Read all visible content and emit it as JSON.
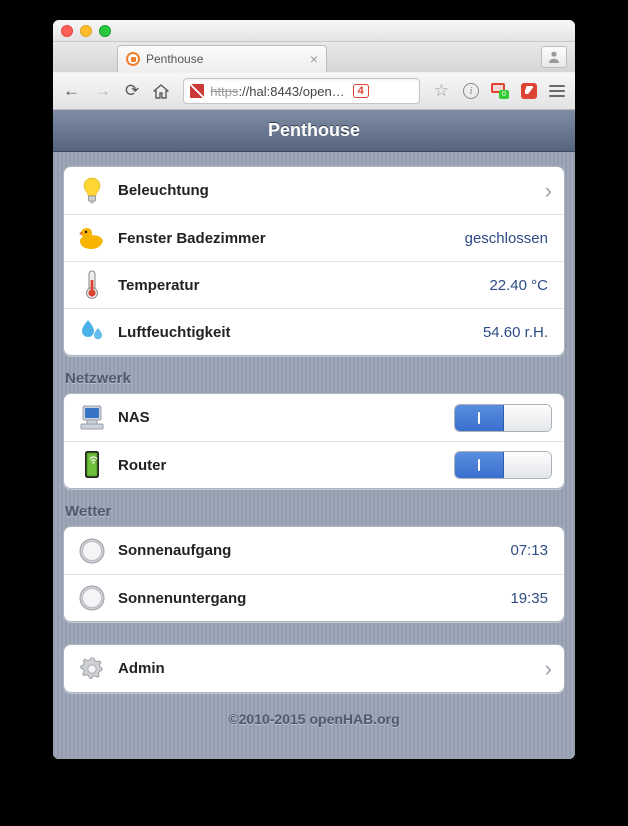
{
  "browser": {
    "tab_title": "Penthouse",
    "url_proto": "https",
    "url_rest": "://hal:8443/open…",
    "notif_count": "4",
    "flag_count": "0"
  },
  "app": {
    "title": "Penthouse",
    "footer": "©2010-2015 openHAB.org"
  },
  "groups": {
    "main": [
      {
        "icon": "bulb",
        "label": "Beleuchtung",
        "type": "nav"
      },
      {
        "icon": "duck",
        "label": "Fenster Badezimmer",
        "type": "value",
        "value": "geschlossen"
      },
      {
        "icon": "thermo",
        "label": "Temperatur",
        "type": "value",
        "value": "22.40 °C"
      },
      {
        "icon": "humidity",
        "label": "Luftfeuchtigkeit",
        "type": "value",
        "value": "54.60 r.H."
      }
    ],
    "network": {
      "title": "Netzwerk",
      "items": [
        {
          "icon": "nas",
          "label": "NAS",
          "type": "toggle",
          "state": true
        },
        {
          "icon": "router",
          "label": "Router",
          "type": "toggle",
          "state": true
        }
      ]
    },
    "weather": {
      "title": "Wetter",
      "items": [
        {
          "icon": "clock",
          "label": "Sonnenaufgang",
          "type": "value",
          "value": "07:13"
        },
        {
          "icon": "clock",
          "label": "Sonnenuntergang",
          "type": "value",
          "value": "19:35"
        }
      ]
    },
    "admin": [
      {
        "icon": "gear",
        "label": "Admin",
        "type": "nav"
      }
    ]
  }
}
